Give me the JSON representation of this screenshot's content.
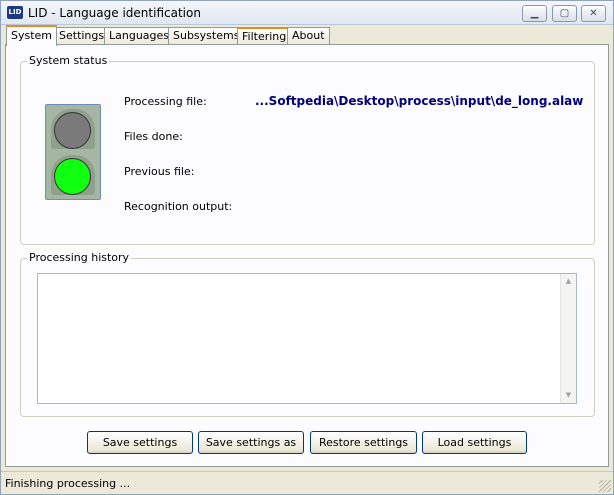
{
  "window": {
    "icon_text": "LID",
    "title": "LID - Language identification",
    "minimize_glyph": "▁",
    "maximize_glyph": "▢",
    "close_glyph": "✕"
  },
  "tabs": [
    {
      "label": "System",
      "active": true
    },
    {
      "label": "Settings",
      "active": false
    },
    {
      "label": "Languages",
      "active": false
    },
    {
      "label": "Subsystems",
      "active": false
    },
    {
      "label": "Filtering",
      "active": false
    },
    {
      "label": "About",
      "active": false
    }
  ],
  "system_status": {
    "group_label": "System status",
    "traffic_light": {
      "top": "off",
      "bottom": "on",
      "on_color": "#11ff11",
      "off_color": "#7a7a7a"
    },
    "processing_file_label": "Processing file:",
    "processing_file_value": "...Softpedia\\Desktop\\process\\input\\de_long.alaw",
    "files_done_label": "Files done:",
    "files_done_value": "",
    "previous_file_label": "Previous file:",
    "previous_file_value": "",
    "recognition_output_label": "Recognition output:",
    "recognition_output_value": ""
  },
  "processing_history": {
    "group_label": "Processing history",
    "scroll_up_icon": "▲",
    "scroll_down_icon": "▼"
  },
  "buttons": {
    "save_settings": "Save settings",
    "save_settings_as": "Save settings as",
    "restore_settings": "Restore settings",
    "load_settings": "Load settings"
  },
  "status": {
    "text": "Finishing processing ..."
  }
}
